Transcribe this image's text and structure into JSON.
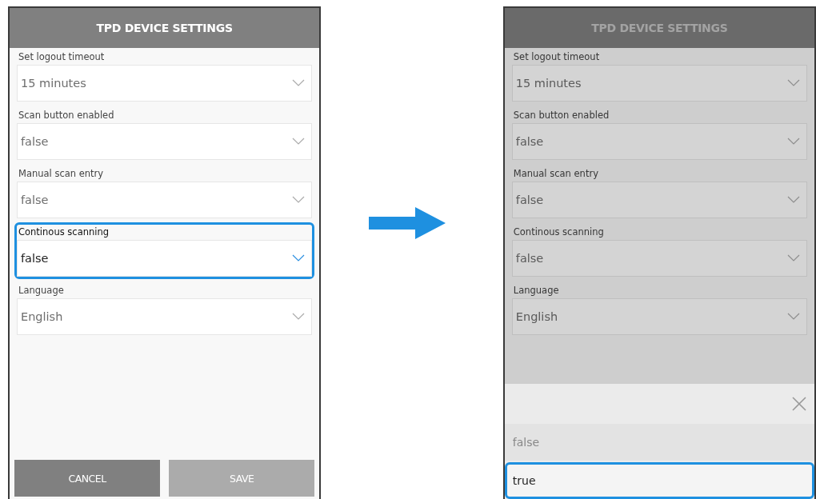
{
  "screens": [
    {
      "title": "TPD DEVICE SETTINGS",
      "dimmed": false,
      "fields": [
        {
          "label": "Set logout timeout",
          "value": "15 minutes",
          "highlighted": false
        },
        {
          "label": "Scan button enabled",
          "value": "false",
          "highlighted": false
        },
        {
          "label": "Manual scan entry",
          "value": "false",
          "highlighted": false
        },
        {
          "label": "Continous scanning",
          "value": "false",
          "highlighted": true
        },
        {
          "label": "Language",
          "value": "English",
          "highlighted": false
        }
      ],
      "buttons": [
        {
          "label": "CANCEL",
          "kind": "cancel"
        },
        {
          "label": "SAVE",
          "kind": "save"
        }
      ]
    },
    {
      "title": "TPD DEVICE SETTINGS",
      "dimmed": true,
      "fields": [
        {
          "label": "Set logout timeout",
          "value": "15 minutes",
          "highlighted": false
        },
        {
          "label": "Scan button enabled",
          "value": "false",
          "highlighted": false
        },
        {
          "label": "Manual scan entry",
          "value": "false",
          "highlighted": false
        },
        {
          "label": "Continous scanning",
          "value": "false",
          "highlighted": false
        },
        {
          "label": "Language",
          "value": "English",
          "highlighted": false
        }
      ],
      "picker": {
        "options": [
          {
            "label": "false",
            "selected": false
          },
          {
            "label": "true",
            "selected": true
          }
        ]
      }
    }
  ]
}
